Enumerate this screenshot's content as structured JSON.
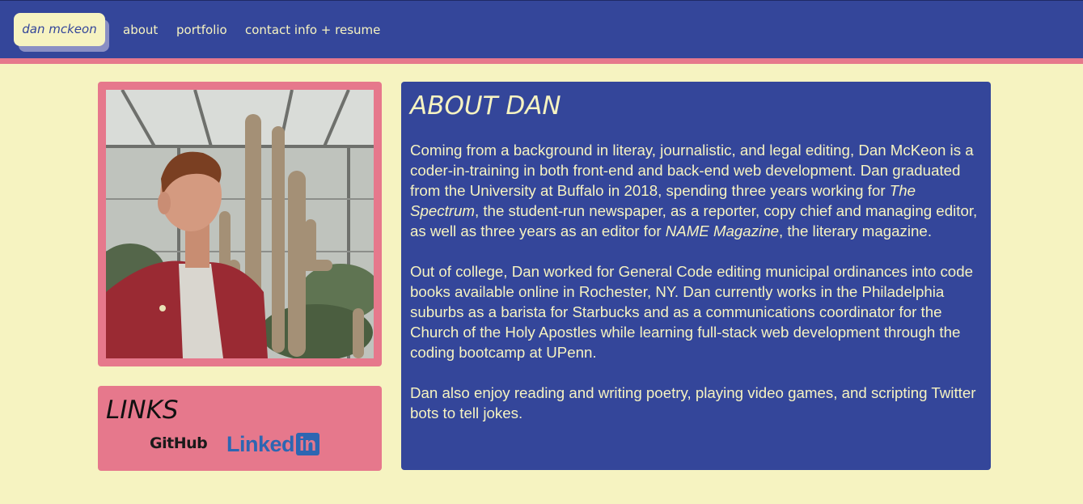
{
  "nav": {
    "brand": "dan mckeon",
    "links": [
      {
        "label": "about"
      },
      {
        "label": "portfolio"
      },
      {
        "label": "contact info + resume"
      }
    ]
  },
  "photo": {
    "description": "portrait-photo"
  },
  "links_section": {
    "title": "LINKS",
    "github_label": "GitHub",
    "linkedin_label_word": "Linked",
    "linkedin_label_box": "in"
  },
  "about": {
    "title": "ABOUT DAN",
    "p1_part1": "Coming from a background in literay, journalistic, and legal editing, Dan McKeon is a coder-in-training in both front-end and back-end web development. Dan graduated from the University at Buffalo in 2018, spending three years working for ",
    "p1_em1": "The Spectrum",
    "p1_part2": ", the student-run newspaper, as a reporter, copy chief and managing editor, as well as three years as an editor for ",
    "p1_em2": "NAME Magazine",
    "p1_part3": ", the literary magazine.",
    "p2": "Out of college, Dan worked for General Code editing municipal ordinances into code books available online in Rochester, NY. Dan currently works in the Philadelphia suburbs as a barista for Starbucks and as a communications coordinator for the Church of the Holy Apostles while learning full-stack web development through the coding bootcamp at UPenn.",
    "p3": "Dan also enjoy reading and writing poetry, playing video games, and scripting Twitter bots to tell jokes."
  },
  "colors": {
    "navy": "#34469a",
    "cream": "#f6f3c1",
    "pink": "#e6788c",
    "linkedin_blue": "#2d66b2"
  },
  "icons": [
    "github-logo-icon",
    "linkedin-logo-icon"
  ]
}
